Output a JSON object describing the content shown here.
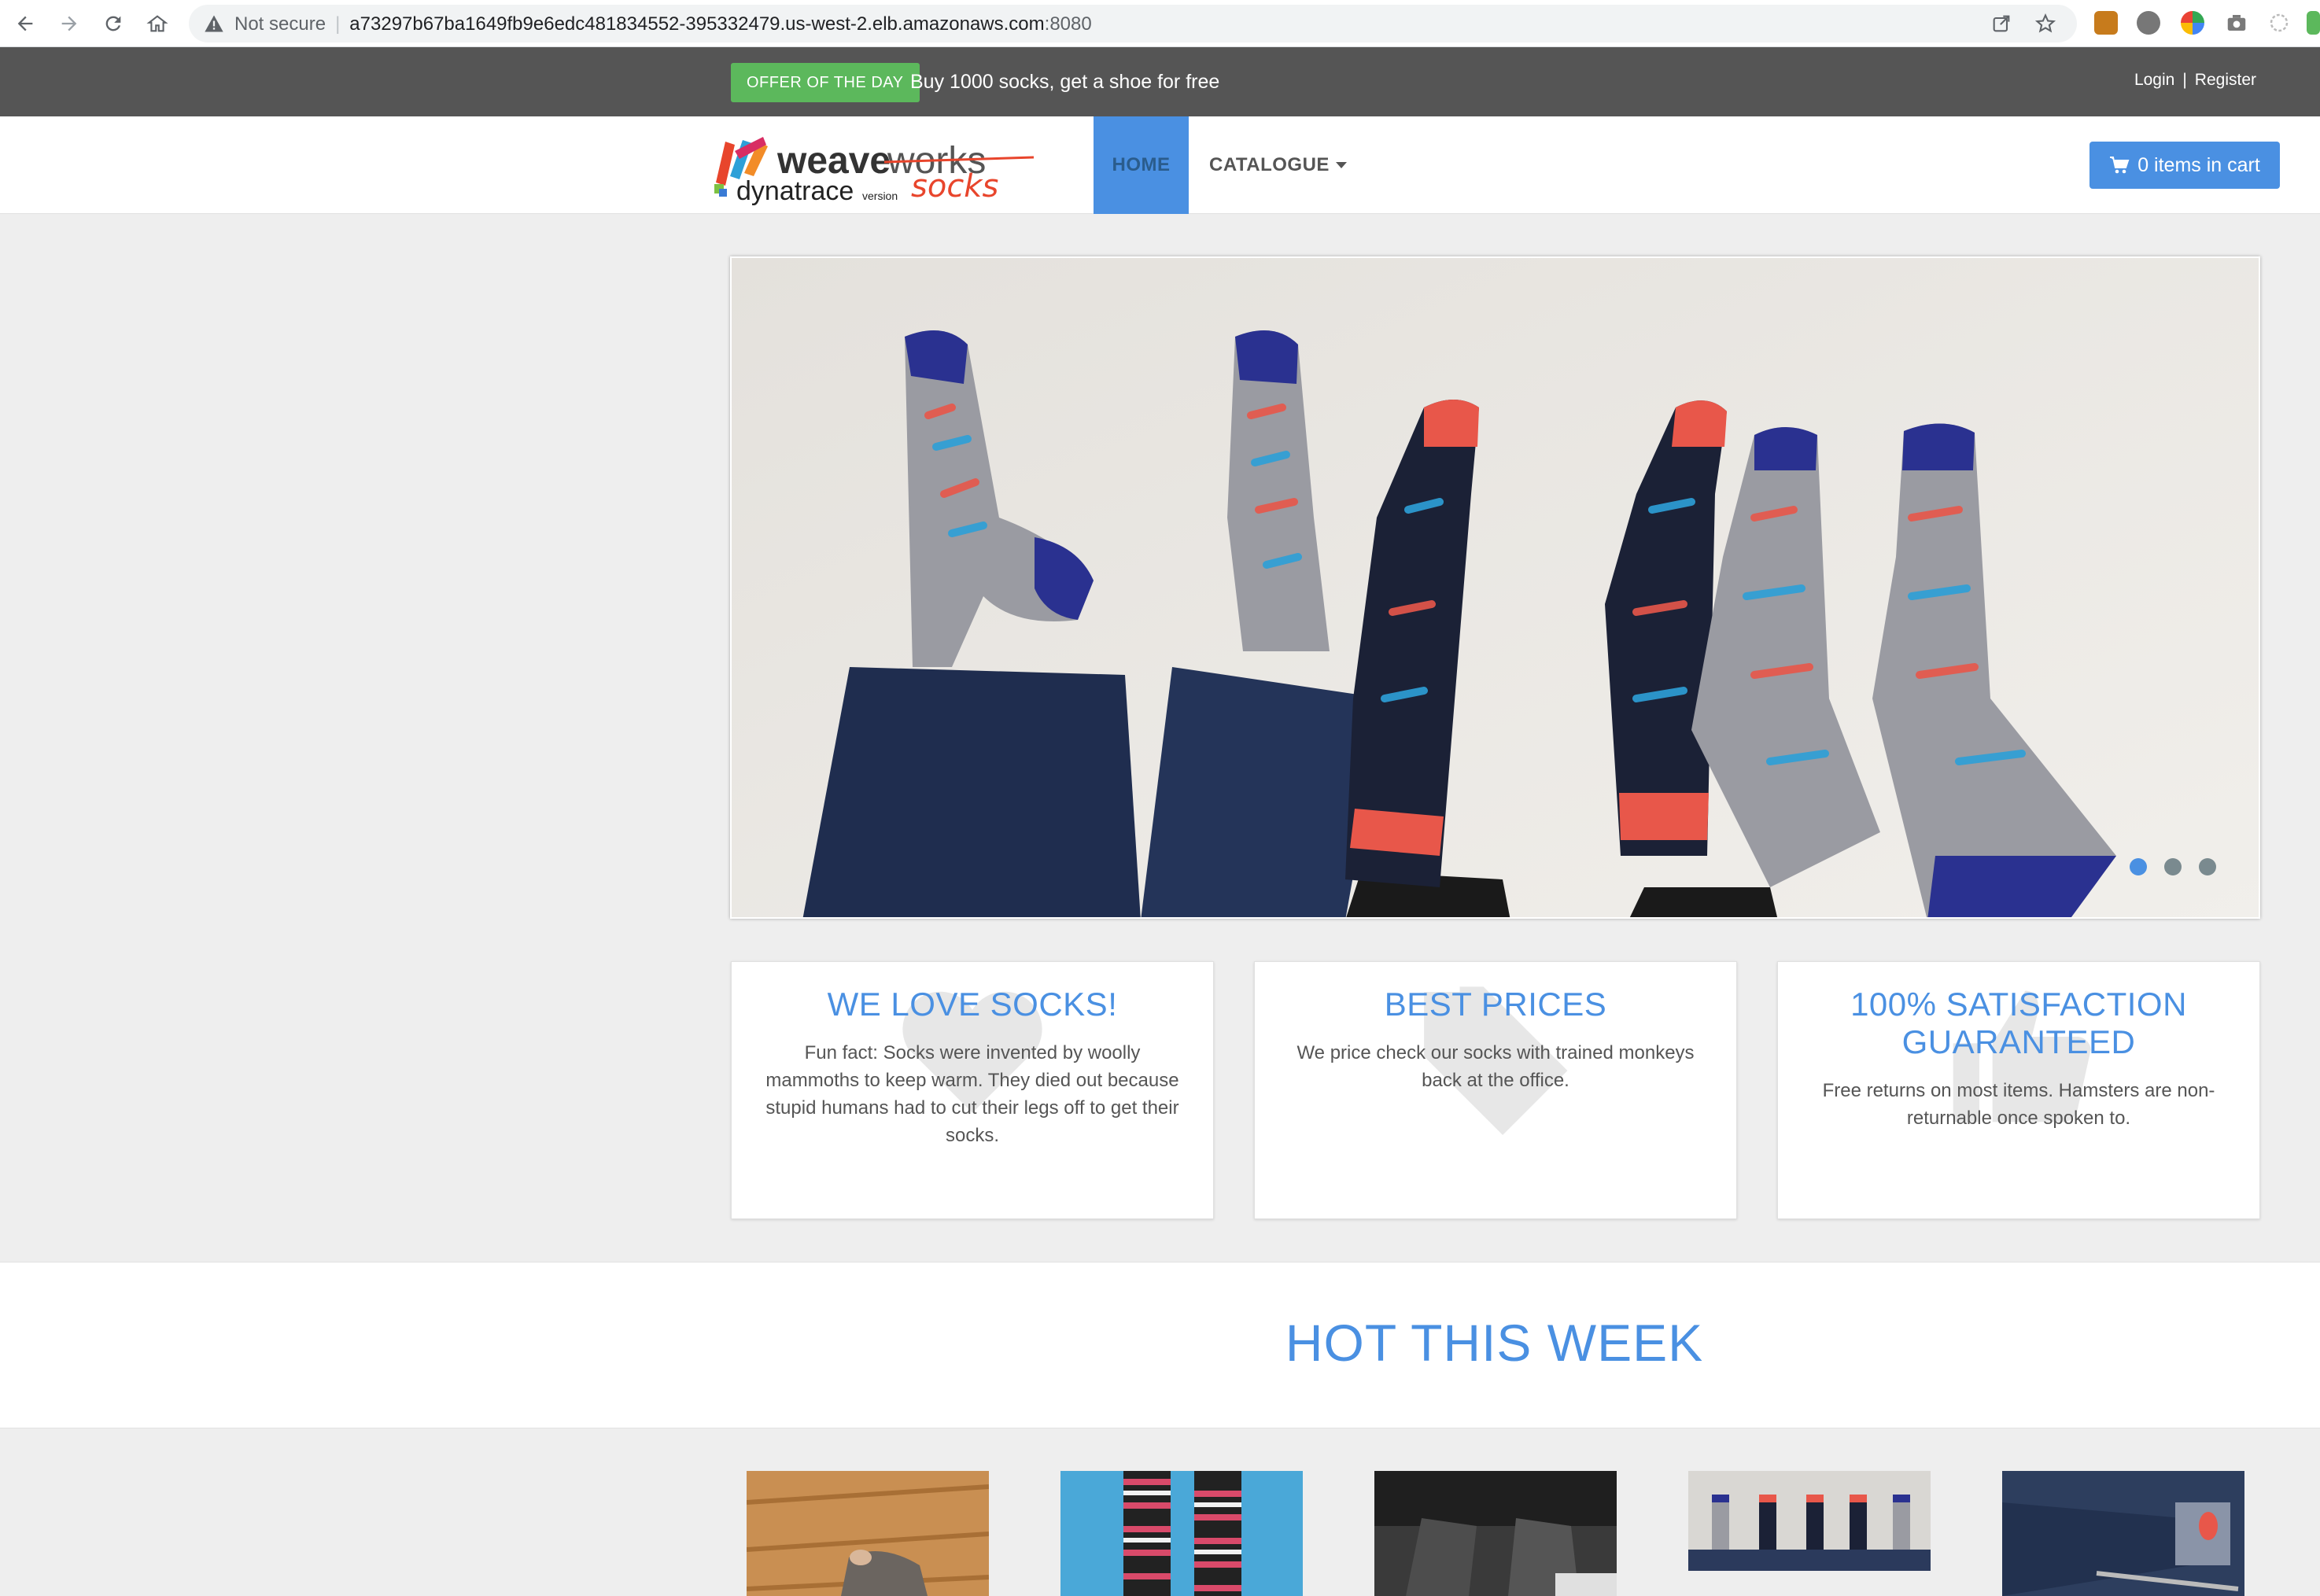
{
  "browser": {
    "security_label": "Not secure",
    "url_host": "a73297b67ba1649fb9e6edc481834552-395332479.us-west-2.elb.amazonaws.com",
    "url_port": ":8080"
  },
  "topbar": {
    "offer_badge": "OFFER OF THE DAY",
    "offer_text": "Buy 1000 socks, get a shoe for free",
    "login": "Login",
    "separator": "|",
    "register": "Register"
  },
  "nav": {
    "logo_alt": "weaveworks socks dynatrace version",
    "logo_word_weave": "weave",
    "logo_word_works": "works",
    "logo_word_dynatrace": "dynatrace",
    "logo_word_version": "version",
    "logo_word_socks": "socks",
    "home": "HOME",
    "catalogue": "CATALOGUE",
    "cart": "0 items in cart"
  },
  "carousel": {
    "slides": 3,
    "active_index": 0
  },
  "features": [
    {
      "title": "WE LOVE SOCKS!",
      "text": "Fun fact: Socks were invented by woolly mammoths to keep warm. They died out because stupid humans had to cut their legs off to get their socks.",
      "icon": "heart-icon"
    },
    {
      "title": "BEST PRICES",
      "text": "We price check our socks with trained monkeys back at the office.",
      "icon": "tag-icon"
    },
    {
      "title": "100% SATISFACTION GUARANTEED",
      "text": "Free returns on most items. Hamsters are non-returnable once spoken to.",
      "icon": "thumbs-up-icon"
    }
  ],
  "hot": {
    "title": "HOT THIS WEEK"
  },
  "colors": {
    "accent": "#4a90e2",
    "offer_green": "#5cb85c",
    "topbar": "#555555",
    "page_bg": "#eeeeee"
  }
}
